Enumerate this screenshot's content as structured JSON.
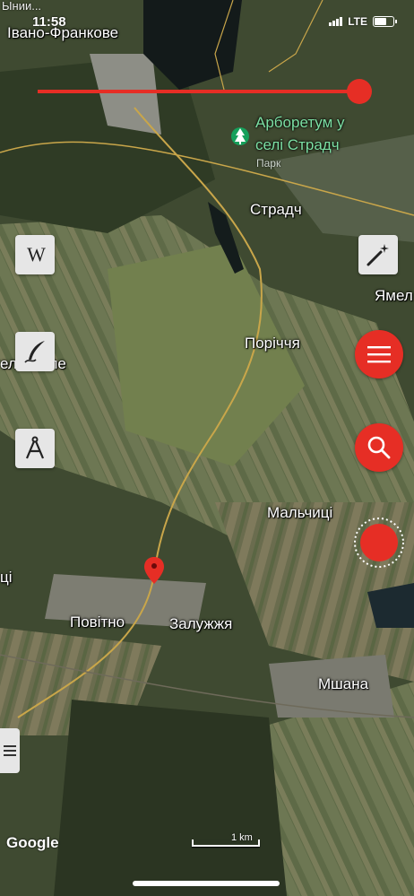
{
  "status_bar": {
    "time": "11:58",
    "network": "LTE",
    "top_label": "Ынии..."
  },
  "map": {
    "places": [
      "Івано-Франкове",
      "Страдч",
      "Ямел",
      "Поріччя",
      "ело Поле",
      "Мальчиці",
      "ці",
      "Повітно",
      "Залужжя",
      "Мшана"
    ],
    "poi": {
      "name_line1": "Арборетум у",
      "name_line2": "селі Страдч",
      "category": "Парк",
      "icon": "tree-icon"
    },
    "marker_icon": "map-pin-icon"
  },
  "controls": {
    "left": [
      "wikipedia-icon",
      "quill-pen-icon",
      "compass-draw-icon"
    ],
    "right": [
      "magic-wand-icon",
      "menu-icon",
      "search-icon",
      "record-icon"
    ],
    "side_tab": "menu-icon",
    "slider_level": 0.97
  },
  "attribution": "Google",
  "scale_label": "1 km",
  "colors": {
    "accent": "#e62e25",
    "poi": "#7ce0a4"
  }
}
